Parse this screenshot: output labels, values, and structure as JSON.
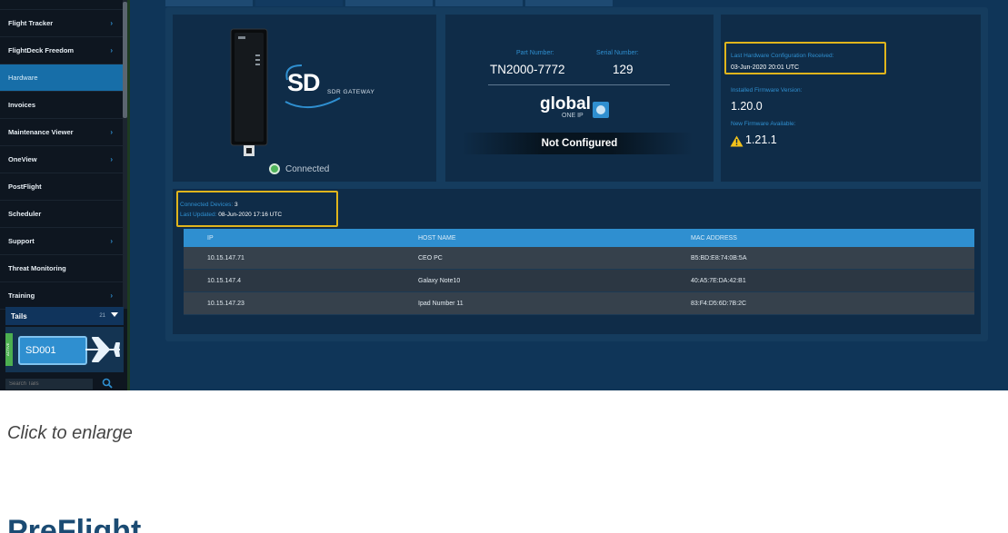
{
  "sidebar": {
    "items": [
      {
        "label": "Flight Tracker",
        "chevron": true,
        "active": false
      },
      {
        "label": "FlightDeck Freedom",
        "chevron": true,
        "active": false
      },
      {
        "label": "Hardware",
        "chevron": false,
        "active": true
      },
      {
        "label": "Invoices",
        "chevron": false,
        "active": false
      },
      {
        "label": "Maintenance Viewer",
        "chevron": true,
        "active": false
      },
      {
        "label": "OneView",
        "chevron": true,
        "active": false
      },
      {
        "label": "PostFlight",
        "chevron": false,
        "active": false
      },
      {
        "label": "Scheduler",
        "chevron": false,
        "active": false
      },
      {
        "label": "Support",
        "chevron": true,
        "active": false
      },
      {
        "label": "Threat Monitoring",
        "chevron": false,
        "active": false
      },
      {
        "label": "Training",
        "chevron": true,
        "active": false
      }
    ],
    "tails_label": "Tails",
    "tails_count": "21",
    "tail_id": "SD001",
    "tail_tag": "ACTIVE",
    "search_placeholder": "Search Tails"
  },
  "device": {
    "logo": "SD",
    "subtitle": "SDR GATEWAY",
    "status": "Connected"
  },
  "identity": {
    "part_number_label": "Part Number:",
    "serial_number_label": "Serial Number:",
    "part_number": "TN2000-7772",
    "serial_number": "129",
    "brand_word": "global",
    "brand_sub": "ONE IP",
    "config_status": "Not Configured"
  },
  "firmware": {
    "last_hw_label": "Last Hardware Configuration Received:",
    "last_hw_value": "03-Jun-2020 20:01 UTC",
    "installed_label": "Installed Firmware Version:",
    "installed_value": "1.20.0",
    "new_label": "New Firmware Available:",
    "new_value": "1.21.1"
  },
  "devices": {
    "connected_label": "Connected Devices:",
    "connected_value": "3",
    "updated_label": "Last Updated:",
    "updated_value": "08-Jun-2020 17:16 UTC",
    "columns": [
      "IP",
      "HOST NAME",
      "MAC ADDRESS"
    ],
    "rows": [
      {
        "ip": "10.15.147.71",
        "host": "CEO PC",
        "mac": "B5:BD:E8:74:0B:5A"
      },
      {
        "ip": "10.15.147.4",
        "host": "Galaxy Note10",
        "mac": "40:A5:7E:DA:42:B1"
      },
      {
        "ip": "10.15.147.23",
        "host": "Ipad Number 11",
        "mac": "83:F4:D5:6D:7B:2C"
      }
    ]
  },
  "page": {
    "caption": "Click to enlarge",
    "heading": "PreFlight"
  },
  "colors": {
    "accent": "#2f8fd0",
    "highlight": "#e0b51c",
    "status_ok": "#4fb45a"
  }
}
